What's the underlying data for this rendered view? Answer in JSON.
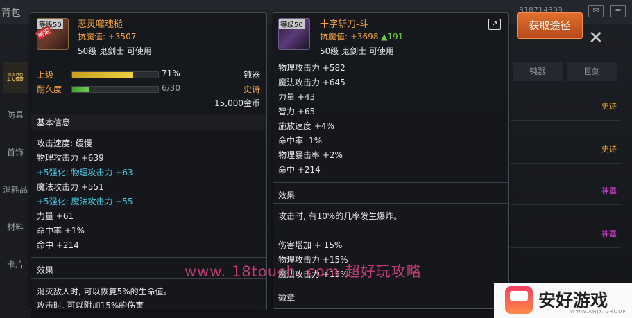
{
  "topbar": {
    "left_text": "背包",
    "right_text": "318714393"
  },
  "left_nav": [
    "武器",
    "防具",
    "首饰",
    "消耗品",
    "材料",
    "卡片"
  ],
  "right_list": {
    "headers": [
      "钝器",
      "巨剑"
    ],
    "tags": [
      {
        "text": "史诗",
        "color": "#e0a030"
      },
      {
        "text": "史诗",
        "color": "#e0a030"
      },
      {
        "text": "神器",
        "color": "#d040d0"
      },
      {
        "text": "神器",
        "color": "#d040d0"
      }
    ]
  },
  "item1": {
    "level_badge": "等级50",
    "bound_tag": "绑定",
    "name": "恶灵噬魂槌",
    "resist_label": "抗魔值: +3507",
    "req": "50级 鬼剑士 可使用",
    "upgrade_label": "上级",
    "upgrade_pct_text": "71%",
    "upgrade_fill": 0.71,
    "type": "钝器",
    "durability_label": "耐久度",
    "durability_text": "6/30",
    "durability_fill": 0.2,
    "rarity": "史诗",
    "price": "15,000金币",
    "section_basic": "基本信息",
    "stats": [
      {
        "text": "攻击速度: 缓慢",
        "color": "white"
      },
      {
        "text": "物理攻击力 +639",
        "color": "white"
      },
      {
        "text": "+5强化: 物理攻击力 +63",
        "color": "cyan"
      },
      {
        "text": "魔法攻击力 +551",
        "color": "white"
      },
      {
        "text": "+5强化: 魔法攻击力 +55",
        "color": "cyan"
      },
      {
        "text": "力量 +61",
        "color": "white"
      },
      {
        "text": "命中率 +1%",
        "color": "white"
      },
      {
        "text": "命中 +214",
        "color": "white"
      }
    ],
    "section_effect": "效果",
    "effect_lines": [
      "消灭敌人时, 可以恢复5%的生命值。",
      "攻击时, 可以附加15%的伤害"
    ]
  },
  "item2": {
    "level_badge": "等级50",
    "name": "十字斩刀-斗",
    "resist_prefix": "抗魔值: +3698",
    "resist_bonus": "▲191",
    "req": "50级 鬼剑士 可使用",
    "stats": [
      "物理攻击力 +582",
      "魔法攻击力 +645",
      "力量 +43",
      "智力 +65",
      "施放速度 +4%",
      "命中率 -1%",
      "物理暴击率 +2%",
      "命中 +214"
    ],
    "section_effect": "效果",
    "effect_line": "攻击时, 有10%的几率发生爆炸。",
    "effect_stats": [
      "伤害增加 + 15%",
      "物理攻击力 +15%",
      "魔法攻击力 +15%"
    ],
    "section_emblem": "徽章"
  },
  "get_button": "获取途径",
  "watermark": "www. 18touch. com  超好玩攻略",
  "logo": {
    "title": "安好游戏",
    "sub": "WWW.AHJX.GROUP"
  }
}
